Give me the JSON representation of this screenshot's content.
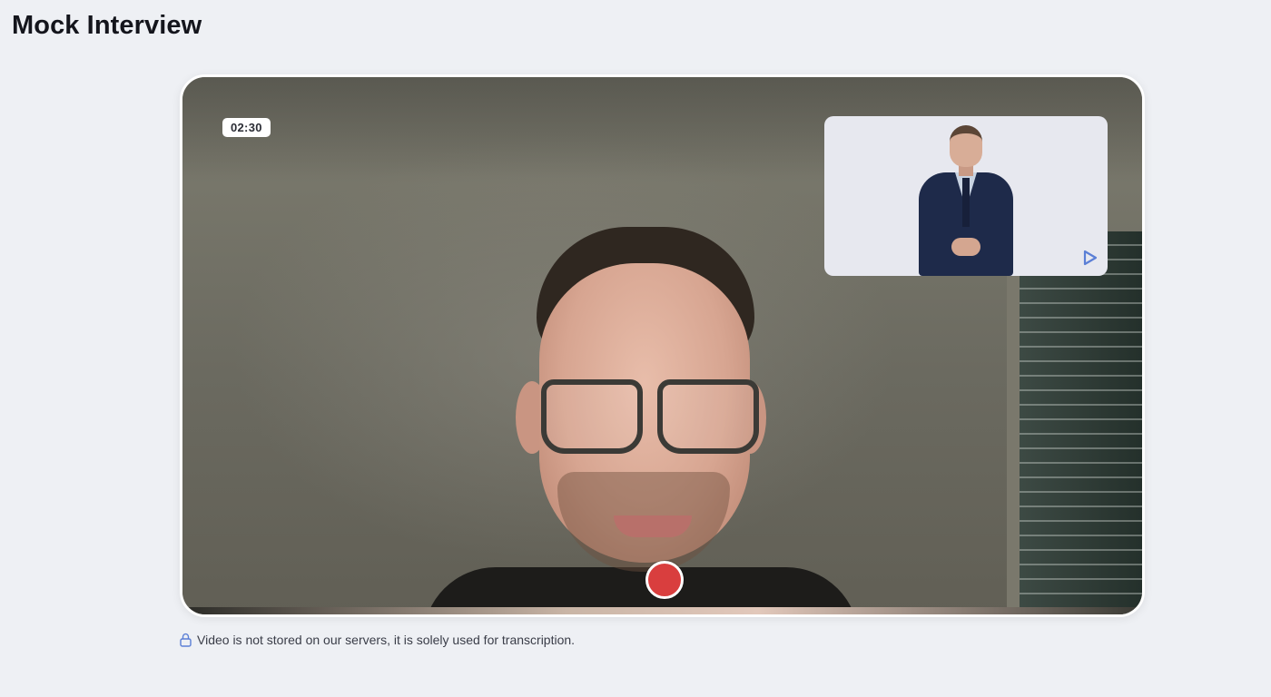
{
  "page": {
    "title": "Mock Interview"
  },
  "video": {
    "timer": "02:30",
    "record_button_color": "#d93e3e",
    "interviewer_icon": "play-triangle-icon"
  },
  "privacy": {
    "icon": "lock-icon",
    "text": "Video is not stored on our servers, it is solely used for transcription."
  },
  "colors": {
    "background": "#eef0f4",
    "frame_border": "#ffffff",
    "record": "#d93e3e",
    "brand_icon": "#5b7fd6"
  }
}
